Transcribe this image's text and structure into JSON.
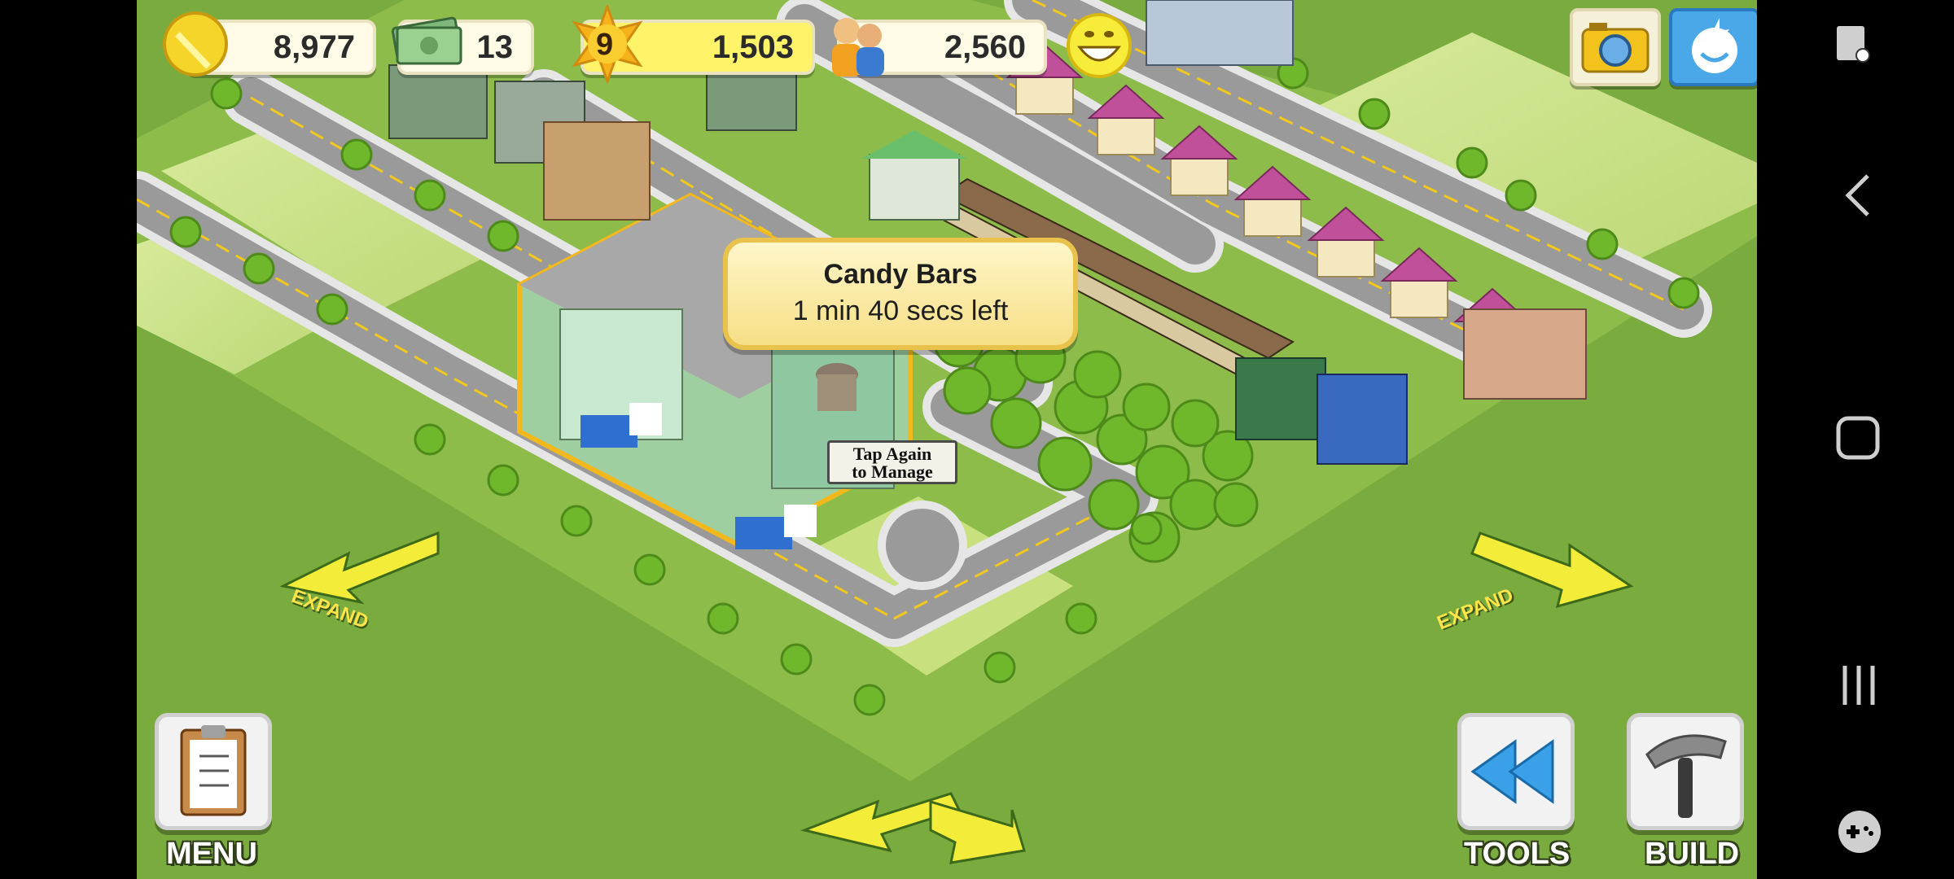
{
  "hud": {
    "coins": "8,977",
    "cash": "13",
    "level": "9",
    "xp": "1,503",
    "population": "2,560"
  },
  "tooltip": {
    "title": "Candy Bars",
    "time_left": "1 min 40 secs left"
  },
  "building_sign": "Tap Again\nto Manage",
  "bottom_buttons": {
    "menu": "MENU",
    "tools": "TOOLS",
    "build": "BUILD"
  },
  "expand_label": "EXPAND",
  "colors": {
    "grass": "#78a83c",
    "road": "#8f8f8f",
    "tooltip_fill": "#f6df86",
    "expand_arrow": "#ffe44a"
  },
  "icons": {
    "coins": "gold-coin-icon",
    "cash": "cash-icon",
    "xp": "star-level-icon",
    "population": "people-icon",
    "happiness": "smiley-icon",
    "camera": "camera-icon",
    "social": "friend-icon",
    "nav_screenshot": "screenshot-icon",
    "nav_back": "back-icon",
    "nav_home": "home-icon",
    "nav_recents": "recents-icon",
    "nav_game": "gamepad-icon"
  }
}
